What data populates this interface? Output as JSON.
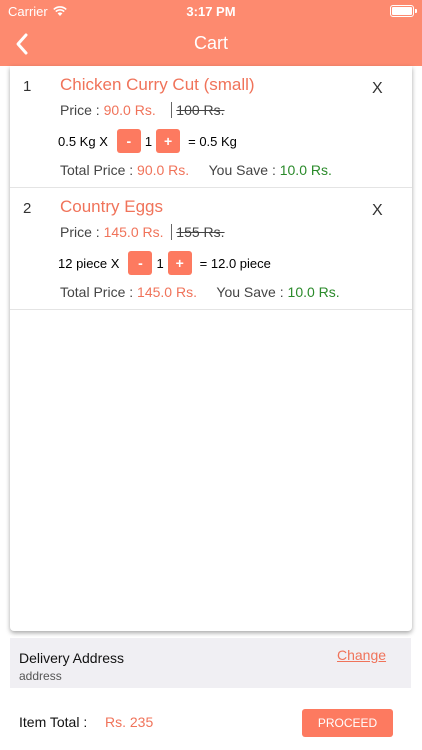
{
  "status_bar": {
    "carrier": "Carrier",
    "time": "3:17 PM"
  },
  "nav": {
    "title": "Cart"
  },
  "cart_items": [
    {
      "index": "1",
      "name": "Chicken Curry Cut (small)",
      "remove_label": "X",
      "price_label": "Price :",
      "price": "90.0 Rs.",
      "mrp": "100 Rs.",
      "unit": "0.5 Kg X",
      "minus_label": "-",
      "quantity": "1",
      "plus_label": "+",
      "result": "= 0.5 Kg",
      "total_label": "Total Price :",
      "total": "90.0 Rs.",
      "save_label": "You Save :",
      "save": "10.0 Rs."
    },
    {
      "index": "2",
      "name": "Country Eggs",
      "remove_label": "X",
      "price_label": "Price :",
      "price": "145.0 Rs.",
      "mrp": "155 Rs.",
      "unit": "12 piece X",
      "minus_label": "-",
      "quantity": "1",
      "plus_label": "+",
      "result": "= 12.0 piece",
      "total_label": "Total Price :",
      "total": "145.0 Rs.",
      "save_label": "You Save :",
      "save": "10.0 Rs."
    }
  ],
  "delivery": {
    "title": "Delivery Address",
    "address": "address",
    "change_label": "Change"
  },
  "footer": {
    "item_total_label": "Item Total :",
    "item_total_value": "Rs. 235",
    "proceed_label": "PROCEED"
  },
  "colors": {
    "accent": "#fd8a6f",
    "price": "#f0735a",
    "save": "#2a8a2a"
  }
}
